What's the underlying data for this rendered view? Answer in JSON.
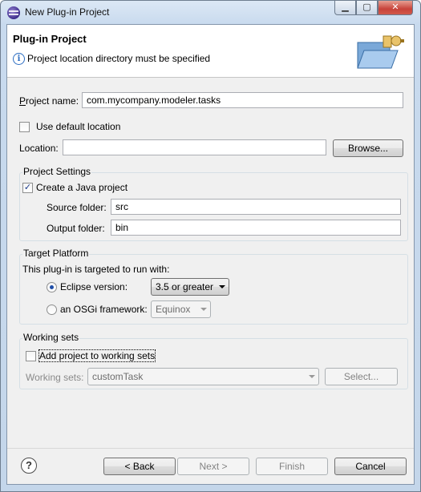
{
  "window": {
    "title": "New Plug-in Project",
    "controls": {
      "minimize": "▁",
      "maximize": "▢",
      "close": "✕"
    }
  },
  "header": {
    "title": "Plug-in Project",
    "message": "Project location directory must be specified",
    "message_icon": "info-icon",
    "banner_icon": "plugin-wizard-icon"
  },
  "project": {
    "name_label": "Project name:",
    "name_value": "com.mycompany.modeler.tasks",
    "use_default_label": "Use default location",
    "use_default_checked": false,
    "location_label": "Location:",
    "location_value": "",
    "browse_label": "Browse..."
  },
  "project_settings": {
    "title": "Project Settings",
    "create_java_label": "Create a Java project",
    "create_java_checked": true,
    "source_folder_label": "Source folder:",
    "source_folder_value": "src",
    "output_folder_label": "Output folder:",
    "output_folder_value": "bin"
  },
  "target_platform": {
    "title": "Target Platform",
    "description": "This plug-in is targeted to run with:",
    "eclipse_label": "Eclipse version:",
    "eclipse_selected": true,
    "eclipse_version": "3.5 or greater",
    "osgi_label": "an OSGi framework:",
    "osgi_selected": false,
    "osgi_framework": "Equinox"
  },
  "working_sets": {
    "title": "Working sets",
    "add_label": "Add project to working sets",
    "add_checked": false,
    "sets_label": "Working sets:",
    "sets_value": "customTask",
    "select_label": "Select..."
  },
  "footer": {
    "help_icon": "help-icon",
    "back_label": "< Back",
    "next_label": "Next >",
    "finish_label": "Finish",
    "cancel_label": "Cancel"
  }
}
